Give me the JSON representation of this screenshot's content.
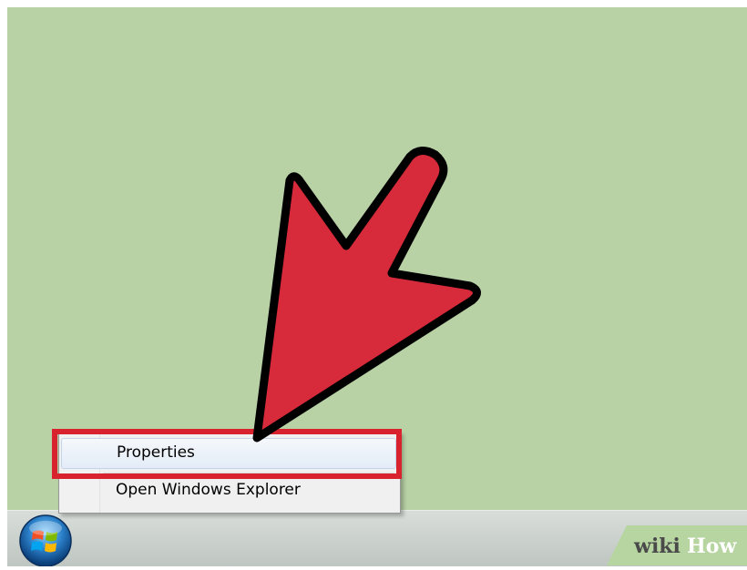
{
  "context_menu": {
    "items": [
      {
        "label": "Properties",
        "highlighted": true
      },
      {
        "label": "Open Windows Explorer",
        "highlighted": false
      }
    ]
  },
  "taskbar": {
    "start_button_icon": "windows-logo-icon"
  },
  "annotation": {
    "arrow_color": "#d72a3a",
    "highlight_color": "#d8232f"
  },
  "watermark": {
    "wiki": "wiki",
    "how": "How"
  },
  "colors": {
    "desktop": "#b8d1a5",
    "taskbar": "#c9cfca"
  }
}
